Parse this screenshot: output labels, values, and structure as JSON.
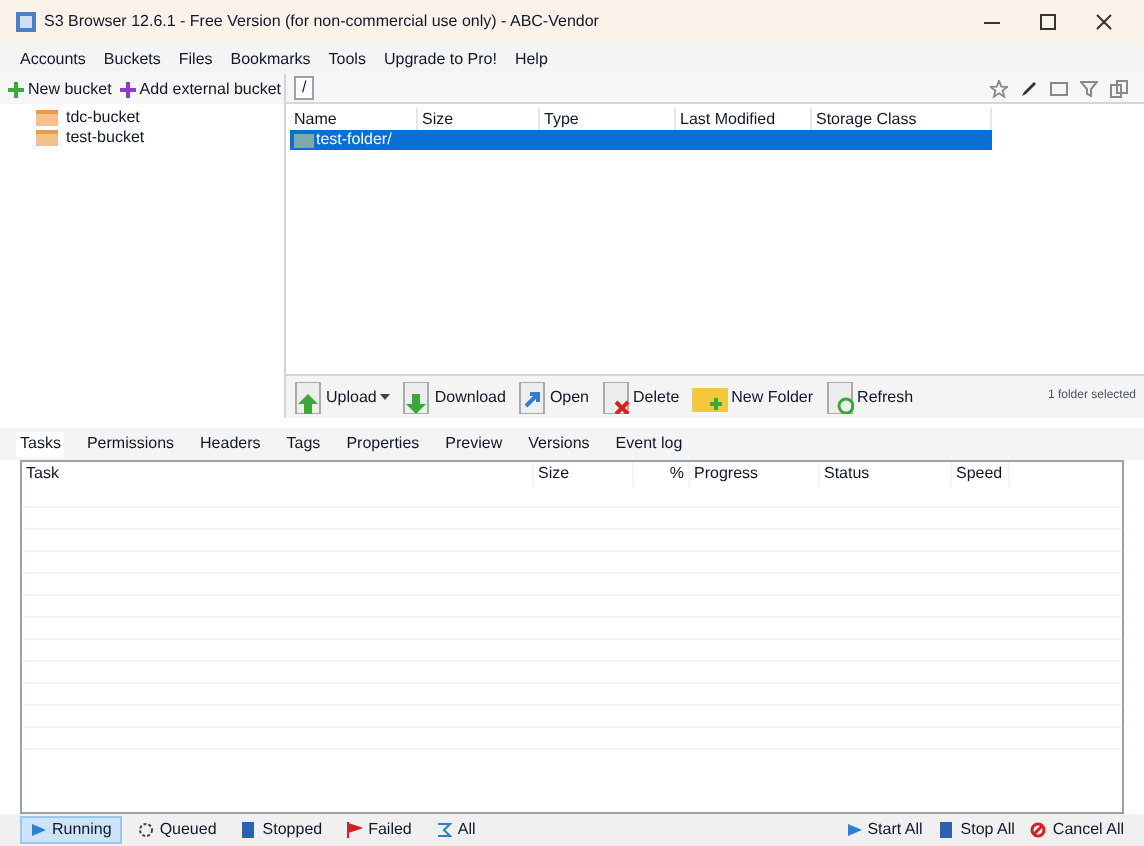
{
  "window": {
    "title": "S3 Browser 12.6.1 - Free Version (for non-commercial use only) - ABC-Vendor"
  },
  "menu": [
    "Accounts",
    "Buckets",
    "Files",
    "Bookmarks",
    "Tools",
    "Upgrade to Pro!",
    "Help"
  ],
  "bucket_toolbar": [
    "New bucket",
    "Add external bucket"
  ],
  "buckets": [
    {
      "name": "tdc-bucket"
    },
    {
      "name": "test-bucket"
    }
  ],
  "path": "/",
  "files": {
    "columns": [
      "Name",
      "Size",
      "Type",
      "Last Modified",
      "Storage Class"
    ],
    "rows": [
      {
        "name": "test-folder/",
        "selected": true
      }
    ]
  },
  "file_actions": [
    {
      "kind": "upload",
      "label": "Upload"
    },
    {
      "kind": "download",
      "label": "Download"
    },
    {
      "kind": "open",
      "label": "Open"
    },
    {
      "kind": "delete",
      "label": "Delete"
    },
    {
      "kind": "newfolder",
      "label": "New Folder"
    },
    {
      "kind": "refresh",
      "label": "Refresh"
    }
  ],
  "selection_status": "1 folder selected",
  "tabs": [
    {
      "label": "Tasks",
      "selected": true
    },
    {
      "label": "Permissions",
      "selected": false
    },
    {
      "label": "Headers",
      "selected": false
    },
    {
      "label": "Tags",
      "selected": false
    },
    {
      "label": "Properties",
      "selected": false
    },
    {
      "label": "Preview",
      "selected": false
    },
    {
      "label": "Versions",
      "selected": false
    },
    {
      "label": "Event log",
      "selected": false
    }
  ],
  "tasks": {
    "columns": [
      "Task",
      "Size",
      "%",
      "Progress",
      "Status",
      "Speed"
    ]
  },
  "task_filters": [
    {
      "kind": "running",
      "label": "Running",
      "selected": true
    },
    {
      "kind": "queued",
      "label": "Queued",
      "selected": false
    },
    {
      "kind": "stopped",
      "label": "Stopped",
      "selected": false
    },
    {
      "kind": "failed",
      "label": "Failed",
      "selected": false
    },
    {
      "kind": "all",
      "label": "All",
      "selected": false
    }
  ],
  "task_actions": [
    {
      "kind": "start",
      "label": "Start All"
    },
    {
      "kind": "stop",
      "label": "Stop All"
    },
    {
      "kind": "cancel",
      "label": "Cancel All"
    }
  ]
}
